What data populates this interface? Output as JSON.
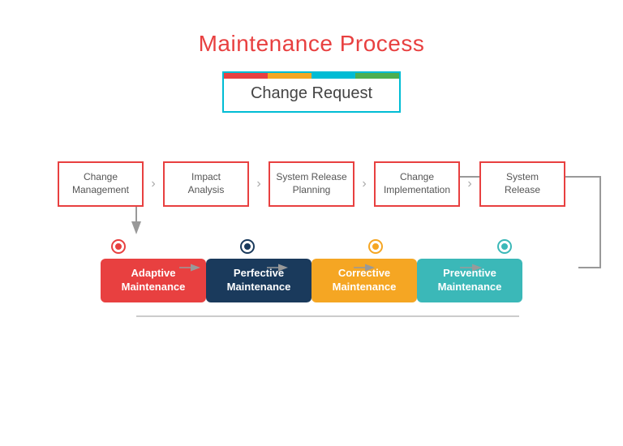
{
  "title": "Maintenance Process",
  "changeRequest": "Change Request",
  "colorBar": [
    "#e84040",
    "#f5a623",
    "#00bcd4",
    "#4caf50"
  ],
  "processBoxes": [
    {
      "label": "Change\nManagement"
    },
    {
      "label": "Impact\nAnalysis"
    },
    {
      "label": "System Release\nPlanning"
    },
    {
      "label": "Change\nImplementation"
    },
    {
      "label": "System\nRelease"
    }
  ],
  "maintenanceBoxes": [
    {
      "label": "Adaptive\nMaintenance",
      "class": "maint-adaptive",
      "dotClass": "dot-adaptive"
    },
    {
      "label": "Perfective\nMaintenance",
      "class": "maint-perfective",
      "dotClass": "dot-perfective"
    },
    {
      "label": "Corrective\nMaintenance",
      "class": "maint-corrective",
      "dotClass": "dot-corrective"
    },
    {
      "label": "Preventive\nMaintenance",
      "class": "maint-preventive",
      "dotClass": "dot-preventive"
    }
  ]
}
